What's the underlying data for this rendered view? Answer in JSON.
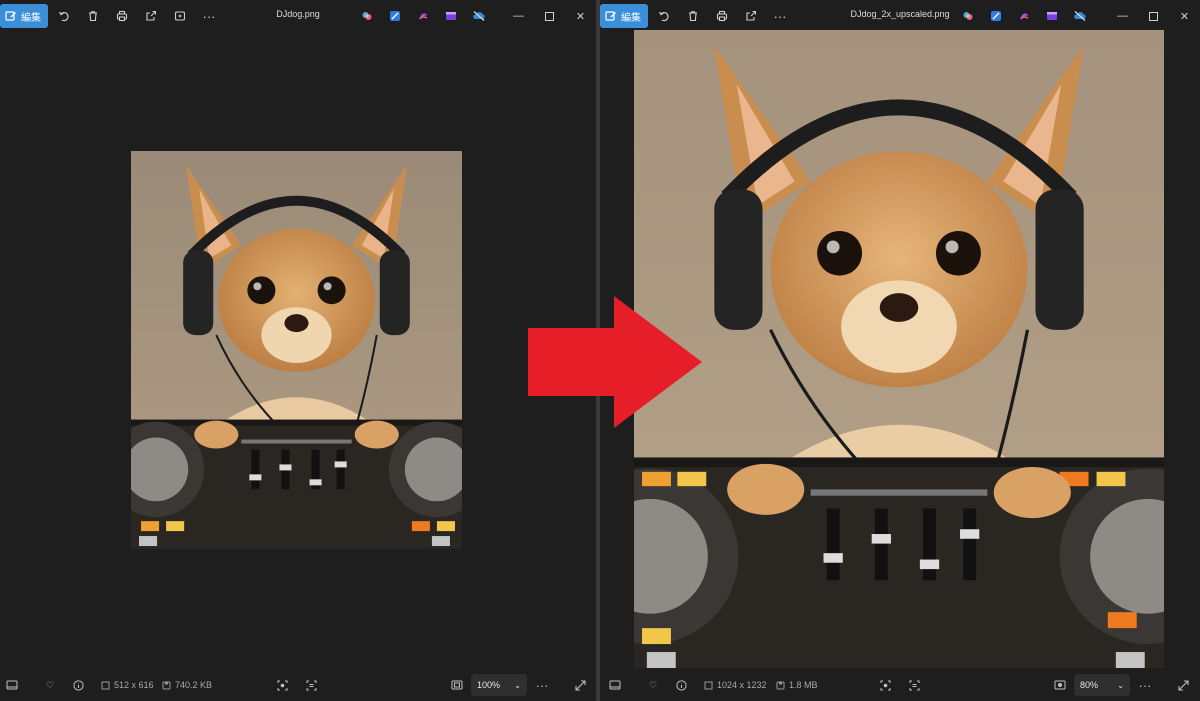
{
  "left": {
    "edit_label": "編集",
    "title": "DJdog.png",
    "dimensions": "512 x 616",
    "file_size": "740.2 KB",
    "zoom": "100%"
  },
  "right": {
    "edit_label": "編集",
    "title": "DJdog_2x_upscaled.png",
    "dimensions": "1024 x 1232",
    "file_size": "1.8 MB",
    "zoom": "80%"
  },
  "icons": {
    "toolbar": [
      "edit-icon",
      "rotate-icon",
      "delete-icon",
      "print-icon",
      "share-icon",
      "slideshow-icon",
      "more-icon"
    ],
    "apps": [
      "copilot-icon",
      "designer-icon",
      "clipchamp-icon",
      "clipchamp-video-icon",
      "onedrive-off-icon"
    ],
    "window": [
      "minimize-icon",
      "maximize-icon",
      "close-icon"
    ],
    "status": [
      "filmstrip-icon",
      "favorite-icon",
      "info-icon",
      "dimension-icon",
      "file-size-icon",
      "visual-search-icon",
      "text-detect-icon",
      "fit-icon",
      "zoom-chevron-icon",
      "more-icon",
      "fullscreen-icon"
    ]
  },
  "colors": {
    "accent": "#3b8fd8",
    "arrow": "#e61e28",
    "background": "#1e1e1e"
  }
}
